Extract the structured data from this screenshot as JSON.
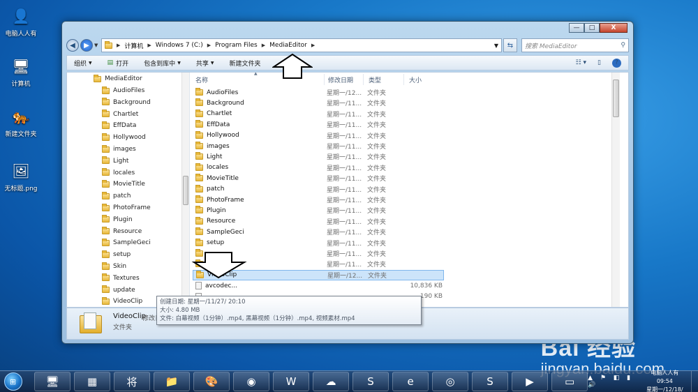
{
  "desktop": {
    "icons": [
      {
        "label": "电脑人人有",
        "glyph": "👤"
      },
      {
        "label": "计算机",
        "glyph": "🖥"
      },
      {
        "label": "新建文件夹",
        "glyph": "🐅"
      },
      {
        "label": "无标题.png",
        "glyph": "🖼"
      }
    ],
    "watermark": {
      "logo": "Bai 经验",
      "url": "jingyan.baidu.com"
    }
  },
  "window": {
    "controls": {
      "minimize": "—",
      "maximize": "□",
      "close": "X"
    },
    "address": [
      "计算机",
      "Windows 7 (C:)",
      "Program Files",
      "MediaEditor"
    ],
    "search_placeholder": "搜索 MediaEditor",
    "toolbar": {
      "organize": "组织",
      "open": "打开",
      "include_in_library": "包含到库中",
      "share": "共享",
      "new_folder": "新建文件夹"
    },
    "nav_tree": {
      "root": "MediaEditor",
      "items": [
        "AudioFiles",
        "Background",
        "Chartlet",
        "EffData",
        "Hollywood",
        "images",
        "Light",
        "locales",
        "MovieTitle",
        "patch",
        "PhotoFrame",
        "Plugin",
        "Resource",
        "SampleGeci",
        "setup",
        "Skin",
        "Textures",
        "update",
        "VideoClip"
      ]
    },
    "columns": {
      "name": "名称",
      "date": "修改日期",
      "type": "类型",
      "size": "大小"
    },
    "files": [
      {
        "name": "AudioFiles",
        "date": "星期一/12...",
        "type": "文件夹",
        "size": ""
      },
      {
        "name": "Background",
        "date": "星期一/11...",
        "type": "文件夹",
        "size": ""
      },
      {
        "name": "Chartlet",
        "date": "星期一/11...",
        "type": "文件夹",
        "size": ""
      },
      {
        "name": "EffData",
        "date": "星期一/11...",
        "type": "文件夹",
        "size": ""
      },
      {
        "name": "Hollywood",
        "date": "星期一/11...",
        "type": "文件夹",
        "size": ""
      },
      {
        "name": "images",
        "date": "星期一/11...",
        "type": "文件夹",
        "size": ""
      },
      {
        "name": "Light",
        "date": "星期一/11...",
        "type": "文件夹",
        "size": ""
      },
      {
        "name": "locales",
        "date": "星期一/11...",
        "type": "文件夹",
        "size": ""
      },
      {
        "name": "MovieTitle",
        "date": "星期一/11...",
        "type": "文件夹",
        "size": ""
      },
      {
        "name": "patch",
        "date": "星期一/11...",
        "type": "文件夹",
        "size": ""
      },
      {
        "name": "PhotoFrame",
        "date": "星期一/11...",
        "type": "文件夹",
        "size": ""
      },
      {
        "name": "Plugin",
        "date": "星期一/11...",
        "type": "文件夹",
        "size": ""
      },
      {
        "name": "Resource",
        "date": "星期一/11...",
        "type": "文件夹",
        "size": ""
      },
      {
        "name": "SampleGeci",
        "date": "星期一/11...",
        "type": "文件夹",
        "size": ""
      },
      {
        "name": "setup",
        "date": "星期一/11...",
        "type": "文件夹",
        "size": ""
      },
      {
        "name": "",
        "date": "星期一/11...",
        "type": "文件夹",
        "size": ""
      },
      {
        "name": "",
        "date": "星期一/11...",
        "type": "文件夹",
        "size": ""
      },
      {
        "name": "VideoClip",
        "date": "星期一/12...",
        "type": "文件夹",
        "size": "",
        "selected": true
      },
      {
        "name": "avcodec...",
        "date": "",
        "type": "",
        "size": "10,836 KB",
        "file": true
      },
      {
        "name": "",
        "date": "",
        "type": "",
        "size": "190 KB",
        "file": true
      }
    ],
    "tooltip": {
      "created": "创建日期: 星期一/11/27/ 20:10",
      "size": "大小: 4.80 MB",
      "files": "文件: 白幕视频（1分钟）.mp4, 黑幕视频（1分钟）.mp4, 视频素材.mp4"
    },
    "details": {
      "name": "VideoClip",
      "meta": "修改日期: 星期一/12/18/ 7",
      "type": "文件夹"
    }
  },
  "taskbar": {
    "apps": [
      "🖥",
      "▦",
      "将",
      "📁",
      "🎨",
      "◉",
      "W",
      "☁",
      "S",
      "e",
      "◎",
      "S",
      "▶",
      "▭"
    ],
    "tray_icons": "▲ ⚑ ◧ ▮ 🔊",
    "clock_line1": "电脑人人有 09:54",
    "clock_line2": "星期一/12/18/"
  }
}
